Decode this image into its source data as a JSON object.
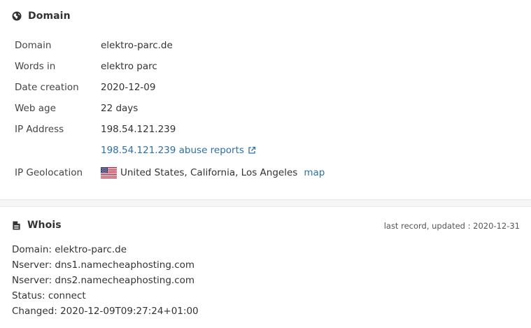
{
  "domain_section": {
    "title": "Domain",
    "icon": "globe-icon",
    "rows": [
      {
        "label": "Domain",
        "value": "elektro-parc.de"
      },
      {
        "label": "Words in",
        "value": "elektro parc"
      },
      {
        "label": "Date creation",
        "value": "2020-12-09"
      },
      {
        "label": "Web age",
        "value": "22 days"
      },
      {
        "label": "IP Address",
        "value": "198.54.121.239"
      }
    ],
    "abuse_link": "198.54.121.239 abuse reports",
    "geolocation": {
      "label": "IP Geolocation",
      "value": "United States, California, Los Angeles",
      "map_link": "map",
      "flag": "us-flag-icon"
    }
  },
  "whois_section": {
    "title": "Whois",
    "icon": "document-icon",
    "meta": "last record, updated : 2020-12-31",
    "lines": [
      "Domain: elektro-parc.de",
      "Nserver: dns1.namecheaphosting.com",
      "Nserver: dns2.namecheaphosting.com",
      "Status: connect",
      "Changed: 2020-12-09T09:27:24+01:00"
    ]
  },
  "colors": {
    "link": "#2a6fb0",
    "text": "#333333",
    "divider": "#f6f6f6"
  }
}
